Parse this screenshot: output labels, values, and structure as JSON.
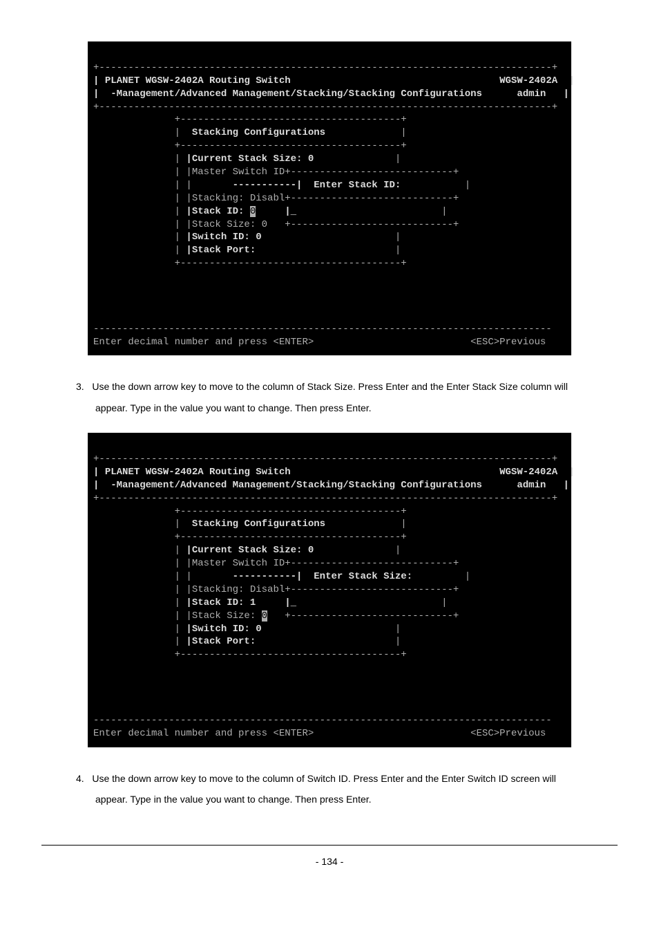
{
  "terminal1": {
    "header_left": "PLANET WGSW-2402A Routing Switch",
    "header_right": "WGSW-2402A",
    "breadcrumb": "-Management/Advanced Management/Stacking/Stacking Configurations",
    "user": "admin",
    "panel_title": "Stacking Configurations",
    "current_stack_size": "|Current Stack Size: 0",
    "master_switch": "|Master Switch ID+----------------------------+",
    "prompt_label": "-----------|  Enter Stack ID:",
    "stacking_line": "|Stacking: Disabl+----------------------------+",
    "stack_id_label": "|Stack ID: ",
    "stack_id_value": "0",
    "stack_id_cursor": "|_",
    "stack_size_line": "|Stack Size: 0   +----------------------------+",
    "switch_id": "|Switch ID: 0",
    "stack_port": "|Stack Port:",
    "footer_left": "Enter decimal number and press <ENTER>",
    "footer_right": "<ESC>Previous"
  },
  "instr1_num": "3.",
  "instr1_text": "Use the down arrow key to move to the column of Stack Size. Press Enter and the Enter Stack Size column will appear. Type in the value you want to change. Then press Enter.",
  "terminal2": {
    "header_left": "PLANET WGSW-2402A Routing Switch",
    "header_right": "WGSW-2402A",
    "breadcrumb": "-Management/Advanced Management/Stacking/Stacking Configurations",
    "user": "admin",
    "panel_title": "Stacking Configurations",
    "current_stack_size": "|Current Stack Size: 0",
    "master_switch": "|Master Switch ID+----------------------------+",
    "prompt_label": "-----------|  Enter Stack Size:",
    "stacking_line": "|Stacking: Disabl+----------------------------+",
    "stack_id_line": "|Stack ID: 1     |_",
    "stack_size_label": "|Stack Size: ",
    "stack_size_value": "0",
    "stack_size_rest": "   +----------------------------+",
    "switch_id": "|Switch ID: 0",
    "stack_port": "|Stack Port:",
    "footer_left": "Enter decimal number and press <ENTER>",
    "footer_right": "<ESC>Previous"
  },
  "instr2_num": "4.",
  "instr2_text": "Use the down arrow key to move to the column of Switch ID. Press Enter and the Enter Switch ID screen will appear. Type in the value you want to change. Then press Enter.",
  "page_number": "- 134 -"
}
